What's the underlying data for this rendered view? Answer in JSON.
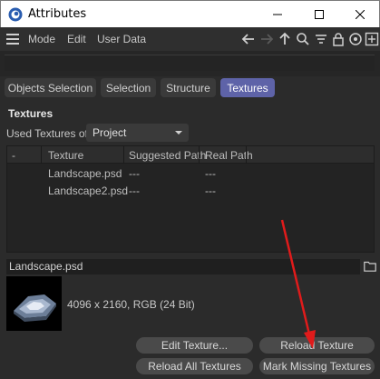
{
  "window": {
    "title": "Attributes",
    "minimize_label": "—",
    "maximize_label": "☐",
    "close_label": "✕"
  },
  "menubar": {
    "items": [
      "Mode",
      "Edit",
      "User Data"
    ],
    "icons": [
      "back-arrow-icon",
      "forward-arrow-icon",
      "up-arrow-icon",
      "search-icon",
      "filter-icon",
      "lock-icon",
      "target-icon",
      "add-icon"
    ]
  },
  "tabs": [
    {
      "label": "Objects Selection",
      "active": false
    },
    {
      "label": "Selection",
      "active": false
    },
    {
      "label": "Structure",
      "active": false
    },
    {
      "label": "Textures",
      "active": true
    }
  ],
  "textures": {
    "section_title": "Textures",
    "used_label": "Used Textures of",
    "used_value": "Project",
    "columns": [
      "-",
      "Texture",
      "Suggested Path",
      "Real Path"
    ],
    "rows": [
      {
        "texture": "Landscape.psd",
        "suggested": "---",
        "real": "---"
      },
      {
        "texture": "Landscape2.psd",
        "suggested": "---",
        "real": "---"
      }
    ],
    "selected_file": "Landscape.psd",
    "image_info": "4096 x 2160, RGB (24 Bit)"
  },
  "buttons": {
    "edit_texture": "Edit Texture...",
    "reload_texture": "Reload Texture",
    "reload_all": "Reload All Textures",
    "mark_missing": "Mark Missing Textures"
  },
  "colors": {
    "accent_tab": "#5e63a8",
    "annotation_arrow": "#e01b1b"
  }
}
